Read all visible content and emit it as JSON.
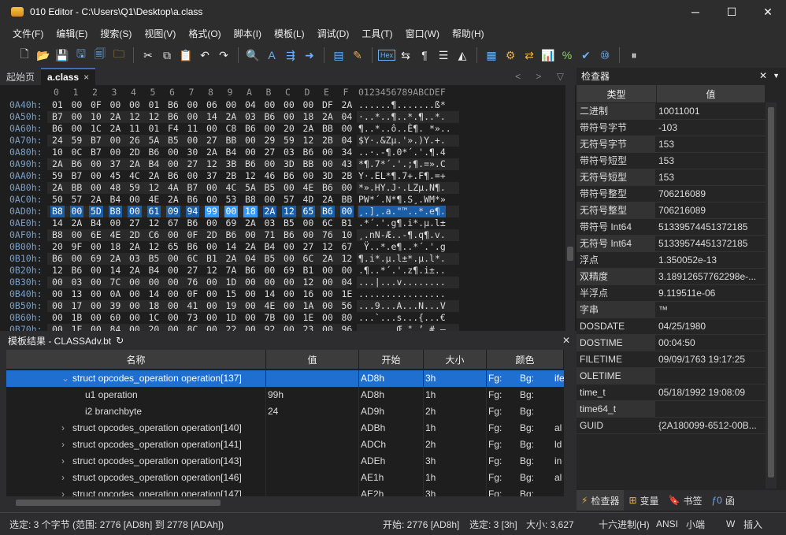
{
  "window": {
    "title": "010 Editor - C:\\Users\\Q1\\Desktop\\a.class",
    "min": "─",
    "max": "☐",
    "close": "✕"
  },
  "menu": [
    "文件(F)",
    "编辑(E)",
    "搜索(S)",
    "视图(V)",
    "格式(O)",
    "脚本(I)",
    "模板(L)",
    "调试(D)",
    "工具(T)",
    "窗口(W)",
    "帮助(H)"
  ],
  "toolbar": {
    "hex_label": "Hex"
  },
  "tabs": [
    {
      "label": "起始页"
    },
    {
      "label": "a.class",
      "close": "×"
    }
  ],
  "tab_nav": "< > ▽",
  "editor": {
    "header_cols": [
      "0",
      "1",
      "2",
      "3",
      "4",
      "5",
      "6",
      "7",
      "8",
      "9",
      "A",
      "B",
      "C",
      "D",
      "E",
      "F"
    ],
    "ascii_header": "0123456789ABCDEF",
    "rows": [
      {
        "addr": "0A40h:",
        "bytes": [
          "01",
          "00",
          "0F",
          "00",
          "00",
          "01",
          "B6",
          "00",
          "06",
          "00",
          "04",
          "00",
          "00",
          "00",
          "DF",
          "2A"
        ],
        "ascii": "......¶.......ß*"
      },
      {
        "addr": "0A50h:",
        "bytes": [
          "B7",
          "00",
          "10",
          "2A",
          "12",
          "12",
          "B6",
          "00",
          "14",
          "2A",
          "03",
          "B6",
          "00",
          "18",
          "2A",
          "04"
        ],
        "ascii": "·..*..¶..*.¶..*."
      },
      {
        "addr": "0A60h:",
        "bytes": [
          "B6",
          "00",
          "1C",
          "2A",
          "11",
          "01",
          "F4",
          "11",
          "00",
          "C8",
          "B6",
          "00",
          "20",
          "2A",
          "BB",
          "00"
        ],
        "ascii": "¶..*..ô..È¶. *».."
      },
      {
        "addr": "0A70h:",
        "bytes": [
          "24",
          "59",
          "B7",
          "00",
          "26",
          "5A",
          "B5",
          "00",
          "27",
          "BB",
          "00",
          "29",
          "59",
          "12",
          "2B",
          "04"
        ],
        "ascii": "$Y·.&Zµ.'».)Y.+."
      },
      {
        "addr": "0A80h:",
        "bytes": [
          "10",
          "0C",
          "B7",
          "00",
          "2D",
          "B6",
          "00",
          "30",
          "2A",
          "B4",
          "00",
          "27",
          "03",
          "B6",
          "00",
          "34"
        ],
        "ascii": "..·.-¶.0*´.'.¶.4"
      },
      {
        "addr": "0A90h:",
        "bytes": [
          "2A",
          "B6",
          "00",
          "37",
          "2A",
          "B4",
          "00",
          "27",
          "12",
          "3B",
          "B6",
          "00",
          "3D",
          "BB",
          "00",
          "43"
        ],
        "ascii": "*¶.7*´.'.;¶.=».C"
      },
      {
        "addr": "0AA0h:",
        "bytes": [
          "59",
          "B7",
          "00",
          "45",
          "4C",
          "2A",
          "B6",
          "00",
          "37",
          "2B",
          "12",
          "46",
          "B6",
          "00",
          "3D",
          "2B"
        ],
        "ascii": "Y·.EL*¶.7+.F¶.=+"
      },
      {
        "addr": "0AB0h:",
        "bytes": [
          "2A",
          "BB",
          "00",
          "48",
          "59",
          "12",
          "4A",
          "B7",
          "00",
          "4C",
          "5A",
          "B5",
          "00",
          "4E",
          "B6",
          "00"
        ],
        "ascii": "*».HY.J·.LZµ.N¶."
      },
      {
        "addr": "0AC0h:",
        "bytes": [
          "50",
          "57",
          "2A",
          "B4",
          "00",
          "4E",
          "2A",
          "B6",
          "00",
          "53",
          "B8",
          "00",
          "57",
          "4D",
          "2A",
          "BB"
        ],
        "ascii": "PW*´.N*¶.S¸.WM*»"
      },
      {
        "addr": "0AD0h:",
        "bytes": [
          "B8",
          "00",
          "5D",
          "B8",
          "00",
          "61",
          "09",
          "94",
          "99",
          "00",
          "18",
          "2A",
          "12",
          "65",
          "B6",
          "00"
        ],
        "ascii": "¸.]¸.a.\"™..*.e¶."
      },
      {
        "addr": "0AE0h:",
        "bytes": [
          "14",
          "2A",
          "B4",
          "00",
          "27",
          "12",
          "67",
          "B6",
          "00",
          "69",
          "2A",
          "03",
          "B5",
          "00",
          "6C",
          "B1"
        ],
        "ascii": ".*´.'.g¶.i*.µ.l±"
      },
      {
        "addr": "0AF0h:",
        "bytes": [
          "B8",
          "00",
          "6E",
          "4E",
          "2D",
          "C6",
          "00",
          "0F",
          "2D",
          "B6",
          "00",
          "71",
          "B6",
          "00",
          "76",
          "10"
        ],
        "ascii": "¸.nN-Æ..-¶.q¶.v."
      },
      {
        "addr": "0B00h:",
        "bytes": [
          "20",
          "9F",
          "00",
          "18",
          "2A",
          "12",
          "65",
          "B6",
          "00",
          "14",
          "2A",
          "B4",
          "00",
          "27",
          "12",
          "67"
        ],
        "ascii": " Ÿ..*.e¶..*´.'.g"
      },
      {
        "addr": "0B10h:",
        "bytes": [
          "B6",
          "00",
          "69",
          "2A",
          "03",
          "B5",
          "00",
          "6C",
          "B1",
          "2A",
          "04",
          "B5",
          "00",
          "6C",
          "2A",
          "12"
        ],
        "ascii": "¶.i*.µ.l±*.µ.l*."
      },
      {
        "addr": "0B20h:",
        "bytes": [
          "12",
          "B6",
          "00",
          "14",
          "2A",
          "B4",
          "00",
          "27",
          "12",
          "7A",
          "B6",
          "00",
          "69",
          "B1",
          "00",
          "00"
        ],
        "ascii": ".¶..*´.'.z¶.i±.."
      },
      {
        "addr": "0B30h:",
        "bytes": [
          "00",
          "03",
          "00",
          "7C",
          "00",
          "00",
          "00",
          "76",
          "00",
          "1D",
          "00",
          "00",
          "00",
          "12",
          "00",
          "04"
        ],
        "ascii": "...|...v........"
      },
      {
        "addr": "0B40h:",
        "bytes": [
          "00",
          "13",
          "00",
          "0A",
          "00",
          "14",
          "00",
          "0F",
          "00",
          "15",
          "00",
          "14",
          "00",
          "16",
          "00",
          "1E"
        ],
        "ascii": "................"
      },
      {
        "addr": "0B50h:",
        "bytes": [
          "00",
          "17",
          "00",
          "39",
          "00",
          "18",
          "00",
          "41",
          "00",
          "19",
          "00",
          "4E",
          "00",
          "1A",
          "00",
          "56"
        ],
        "ascii": "...9...A...N...V"
      },
      {
        "addr": "0B60h:",
        "bytes": [
          "00",
          "1B",
          "00",
          "60",
          "00",
          "1C",
          "00",
          "73",
          "00",
          "1D",
          "00",
          "7B",
          "00",
          "1E",
          "00",
          "80"
        ],
        "ascii": "...`...s...{...€"
      },
      {
        "addr": "0B70h:",
        "bytes": [
          "00",
          "1F",
          "00",
          "84",
          "00",
          "20",
          "00",
          "8C",
          "00",
          "22",
          "00",
          "92",
          "00",
          "23",
          "00",
          "96"
        ],
        "ascii": "...„. .Œ.\".’.#.–"
      }
    ]
  },
  "template": {
    "title": "模板结果 - CLASSAdv.bt",
    "refresh": "↻",
    "close": "✕",
    "columns": [
      "名称",
      "值",
      "开始",
      "大小",
      "颜色"
    ],
    "rows": [
      {
        "expander": "⌄",
        "name": "struct opcodes_operation operation[137]",
        "value": "",
        "start": "AD8h",
        "size": "3h",
        "fg": "Fg:",
        "bg": "Bg:",
        "extra": "ife",
        "selected": true
      },
      {
        "expander": "",
        "name": "u1 operation",
        "value": "99h",
        "start": "AD8h",
        "size": "1h",
        "fg": "Fg:",
        "bg": "Bg:",
        "extra": "",
        "selected": false
      },
      {
        "expander": "",
        "name": "i2 branchbyte",
        "value": "24",
        "start": "AD9h",
        "size": "2h",
        "fg": "Fg:",
        "bg": "Bg:",
        "extra": "",
        "selected": false
      },
      {
        "expander": "›",
        "name": "struct opcodes_operation operation[140]",
        "value": "",
        "start": "ADBh",
        "size": "1h",
        "fg": "Fg:",
        "bg": "Bg:",
        "extra": "al",
        "selected": false
      },
      {
        "expander": "›",
        "name": "struct opcodes_operation operation[141]",
        "value": "",
        "start": "ADCh",
        "size": "2h",
        "fg": "Fg:",
        "bg": "Bg:",
        "extra": "ld",
        "selected": false
      },
      {
        "expander": "›",
        "name": "struct opcodes_operation operation[143]",
        "value": "",
        "start": "ADEh",
        "size": "3h",
        "fg": "Fg:",
        "bg": "Bg:",
        "extra": "in",
        "selected": false
      },
      {
        "expander": "›",
        "name": "struct opcodes_operation operation[146]",
        "value": "",
        "start": "AE1h",
        "size": "1h",
        "fg": "Fg:",
        "bg": "Bg:",
        "extra": "al",
        "selected": false
      },
      {
        "expander": "›",
        "name": "struct opcodes_operation operation[147]",
        "value": "",
        "start": "AE2h",
        "size": "3h",
        "fg": "Fg:",
        "bg": "Bg:",
        "extra": "",
        "selected": false
      }
    ]
  },
  "inspector": {
    "title": "检查器",
    "close": "✕",
    "dropdown": "▼",
    "columns": [
      "类型",
      "值"
    ],
    "rows": [
      {
        "k": "二进制",
        "v": "10011001"
      },
      {
        "k": "带符号字节",
        "v": "-103"
      },
      {
        "k": "无符号字节",
        "v": "153"
      },
      {
        "k": "带符号短型",
        "v": "153"
      },
      {
        "k": "无符号短型",
        "v": "153"
      },
      {
        "k": "带符号整型",
        "v": "706216089"
      },
      {
        "k": "无符号整型",
        "v": "706216089"
      },
      {
        "k": "带符号 Int64",
        "v": "5133957445137218‌5"
      },
      {
        "k": "无符号 Int64",
        "v": "5133957445137218‌5"
      },
      {
        "k": "浮点",
        "v": "1.350052e-13"
      },
      {
        "k": "双精度",
        "v": "3.18912657762298e-..."
      },
      {
        "k": "半浮点",
        "v": "9.119511e-06"
      },
      {
        "k": "字串",
        "v": "™"
      },
      {
        "k": "DOSDATE",
        "v": "04/25/1980"
      },
      {
        "k": "DOSTIME",
        "v": "00:04:50"
      },
      {
        "k": "FILETIME",
        "v": "09/09/1763 19:17:25"
      },
      {
        "k": "OLETIME",
        "v": ""
      },
      {
        "k": "time_t",
        "v": "05/18/1992 19:08:09"
      },
      {
        "k": "time64_t",
        "v": ""
      },
      {
        "k": "GUID",
        "v": "{2A180099-6512-00B..."
      }
    ],
    "tabs": [
      "检查器",
      "变量",
      "书签",
      "函"
    ]
  },
  "status": {
    "left": "选定: 3 个字节 (范围: 2776 [AD8h] 到 2778 [ADAh])",
    "start": "开始: 2776 [AD8h]",
    "sel": "选定: 3 [3h]",
    "size": "大小: 3,627",
    "mode": "十六进制(H)",
    "enc": "ANSI",
    "endian": "小端",
    "w": "W",
    "ins": "插入"
  }
}
